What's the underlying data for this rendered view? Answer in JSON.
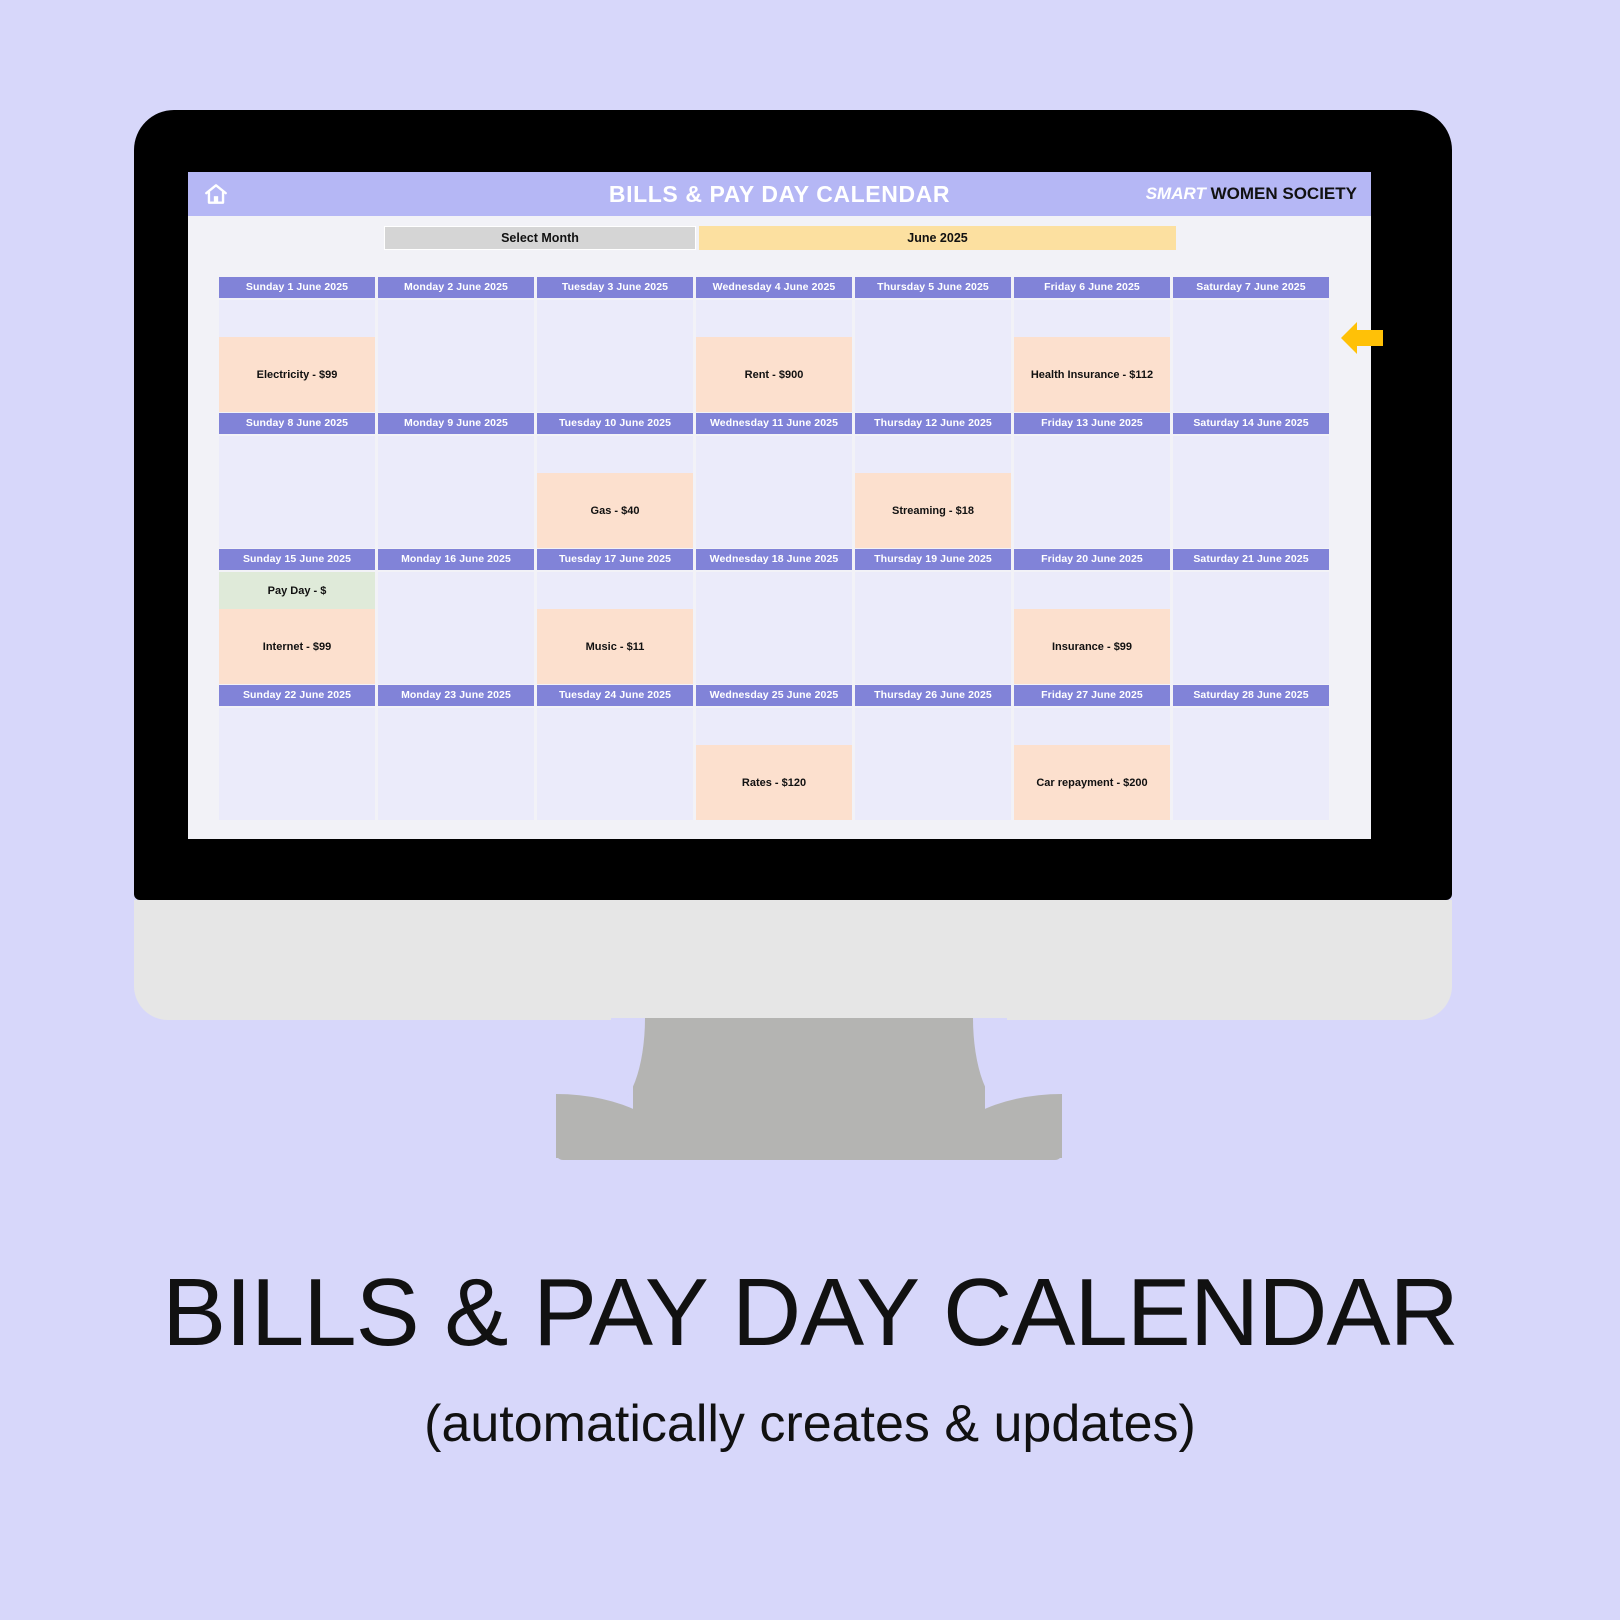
{
  "app": {
    "banner_title": "BILLS & PAY DAY CALENDAR",
    "brand_first": "SMART",
    "brand_rest": "WOMEN SOCIETY",
    "home_icon": "home-icon",
    "arrow_icon": "left-arrow-icon"
  },
  "selector": {
    "label": "Select Month",
    "value": "June 2025"
  },
  "colors": {
    "page_background": "#d7d7fa",
    "banner": "#b5b7f5",
    "day_header": "#8183d8",
    "day_cell": "#ebebfa",
    "bill_cell": "#fce0ce",
    "payday_cell": "#dfead9",
    "month_value": "#fce0a0",
    "select_month": "#d5d5d5",
    "arrow": "#ffc107"
  },
  "calendar": {
    "weeks": [
      {
        "days": [
          {
            "header": "Sunday 1 June 2025",
            "payday": "",
            "bill": "Electricity - $99"
          },
          {
            "header": "Monday 2 June 2025",
            "payday": "",
            "bill": ""
          },
          {
            "header": "Tuesday 3 June 2025",
            "payday": "",
            "bill": ""
          },
          {
            "header": "Wednesday 4 June 2025",
            "payday": "",
            "bill": "Rent - $900"
          },
          {
            "header": "Thursday 5 June 2025",
            "payday": "",
            "bill": ""
          },
          {
            "header": "Friday 6 June 2025",
            "payday": "",
            "bill": "Health Insurance - $112"
          },
          {
            "header": "Saturday 7 June 2025",
            "payday": "",
            "bill": ""
          }
        ]
      },
      {
        "days": [
          {
            "header": "Sunday 8 June 2025",
            "payday": "",
            "bill": ""
          },
          {
            "header": "Monday 9 June 2025",
            "payday": "",
            "bill": ""
          },
          {
            "header": "Tuesday 10 June 2025",
            "payday": "",
            "bill": "Gas - $40"
          },
          {
            "header": "Wednesday 11 June 2025",
            "payday": "",
            "bill": ""
          },
          {
            "header": "Thursday 12 June 2025",
            "payday": "",
            "bill": "Streaming - $18"
          },
          {
            "header": "Friday 13 June 2025",
            "payday": "",
            "bill": ""
          },
          {
            "header": "Saturday 14 June 2025",
            "payday": "",
            "bill": ""
          }
        ]
      },
      {
        "days": [
          {
            "header": "Sunday 15 June 2025",
            "payday": "Pay Day - $",
            "bill": "Internet - $99"
          },
          {
            "header": "Monday 16 June 2025",
            "payday": "",
            "bill": ""
          },
          {
            "header": "Tuesday 17 June 2025",
            "payday": "",
            "bill": "Music - $11"
          },
          {
            "header": "Wednesday 18 June 2025",
            "payday": "",
            "bill": ""
          },
          {
            "header": "Thursday 19 June 2025",
            "payday": "",
            "bill": ""
          },
          {
            "header": "Friday 20 June 2025",
            "payday": "",
            "bill": "Insurance - $99"
          },
          {
            "header": "Saturday 21 June 2025",
            "payday": "",
            "bill": ""
          }
        ]
      },
      {
        "days": [
          {
            "header": "Sunday 22 June 2025",
            "payday": "",
            "bill": ""
          },
          {
            "header": "Monday 23 June 2025",
            "payday": "",
            "bill": ""
          },
          {
            "header": "Tuesday 24 June 2025",
            "payday": "",
            "bill": ""
          },
          {
            "header": "Wednesday 25 June 2025",
            "payday": "",
            "bill": "Rates - $120"
          },
          {
            "header": "Thursday 26 June 2025",
            "payday": "",
            "bill": ""
          },
          {
            "header": "Friday 27 June 2025",
            "payday": "",
            "bill": "Car repayment - $200"
          },
          {
            "header": "Saturday 28 June 2025",
            "payday": "",
            "bill": ""
          }
        ]
      }
    ]
  },
  "captions": {
    "title": "BILLS & PAY DAY CALENDAR",
    "subtitle": "(automatically creates & updates)"
  }
}
